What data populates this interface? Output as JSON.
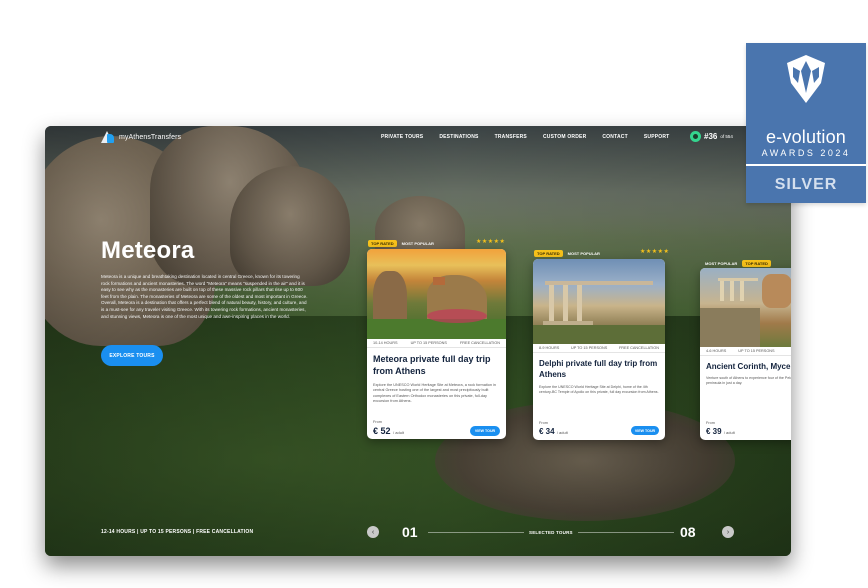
{
  "site": {
    "logo_text": "myAthensTransfers",
    "nav": [
      "PRIVATE TOURS",
      "DESTINATIONS",
      "TRANSFERS",
      "CUSTOM ORDER",
      "CONTACT",
      "SUPPORT"
    ],
    "rank_number": "#36",
    "rank_of": "of 554"
  },
  "hero": {
    "title": "Meteora",
    "description": "Meteora is a unique and breathtaking destination located in central Greece, known for its towering rock formations and ancient monasteries. The word \"Meteora\" means \"suspended in the air\" and it is easy to see why as the monasteries are built on top of these massive rock pillars that rise up to 600 feet from the plain. The monasteries of Meteora are some of the oldest and most important in Greece. Overall, Meteora is a destination that offers a perfect blend of natural beauty, history, and culture, and is a must-see for any traveler visiting Greece. With its towering rock formations, ancient monasteries, and stunning views, Meteora is one of the most unique and awe-inspiring places in the world.",
    "cta": "EXPLORE TOURS"
  },
  "cards": [
    {
      "badge_top": "TOP RATED",
      "badge_popular": "MOST POPULAR",
      "stars": "★★★★★",
      "hours": "10-14 HOURS",
      "persons": "UP TO 15 PERSONS",
      "cancel": "FREE CANCELLATION",
      "title": "Meteora private full day trip from Athens",
      "desc": "Explore the UNESCO World Heritage Site at Meteora, a rock formation in central Greece hosting one of the largest and most precipitously built complexes of Eastern Orthodox monasteries on this private, full-day excursion from Athens.",
      "from_label": "From",
      "price": "€ 52",
      "price_unit": "/ adult",
      "button": "VIEW TOUR"
    },
    {
      "badge_top": "TOP RATED",
      "badge_popular": "MOST POPULAR",
      "stars": "★★★★★",
      "hours": "8-9 HOURS",
      "persons": "UP TO 15 PERSONS",
      "cancel": "FREE CANCELLATION",
      "title": "Delphi private full day trip from Athens",
      "desc": "Explore the UNESCO World Heritage Site at Delphi, home of the 4th century-BC Temple of Apollo on this private, full day excursion from Athens.",
      "from_label": "From",
      "price": "€ 34",
      "price_unit": "/ adult",
      "button": "VIEW TOUR"
    },
    {
      "badge_popular": "MOST POPULAR",
      "badge_top": "TOP RATED",
      "hours": "4-6 HOURS",
      "persons": "UP TO 15 PERSONS",
      "title": "Ancient Corinth, Myce... Epidaurus, Nafplio ...",
      "desc": "Venture south of Athens to experience four of the Peloponnese peninsula in just a day.",
      "from_label": "From",
      "price": "€ 39",
      "price_unit": "/ adult"
    }
  ],
  "slider": {
    "info": "12-14 HOURS | UP TO 15 PERSONS | FREE CANCELLATION",
    "current": "01",
    "label": "SELECTED TOURS",
    "total": "08",
    "prev_icon": "‹",
    "next_icon": "›"
  },
  "award": {
    "title": "e-volution",
    "subtitle": "AWARDS 2024",
    "level": "SILVER"
  }
}
